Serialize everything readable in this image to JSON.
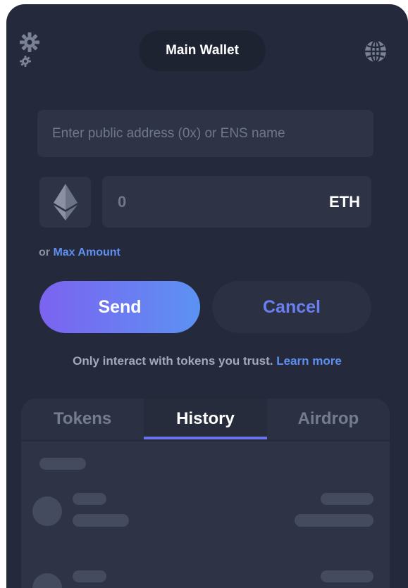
{
  "header": {
    "wallet_name": "Main Wallet",
    "settings_icon": "gear-icon",
    "network_icon": "globe-icon"
  },
  "send_form": {
    "address_placeholder": "Enter public address (0x) or ENS name",
    "token_icon": "ethereum-icon",
    "amount_value": "0",
    "amount_unit": "ETH",
    "max_prefix": "or ",
    "max_link": "Max Amount",
    "send_label": "Send",
    "cancel_label": "Cancel"
  },
  "notice": {
    "text": "Only interact with tokens you trust. ",
    "link": "Learn more"
  },
  "tabs": {
    "items": [
      {
        "label": "Tokens"
      },
      {
        "label": "History"
      },
      {
        "label": "Airdrop"
      }
    ],
    "active": "History"
  },
  "colors": {
    "panel_bg": "#242a3b",
    "accent_blue": "#5f8ff0",
    "send_gradient_start": "#7b63f0",
    "send_gradient_end": "#5c92f3",
    "cancel_text": "#6a7ff0",
    "tab_indicator": "#6b72ea"
  }
}
